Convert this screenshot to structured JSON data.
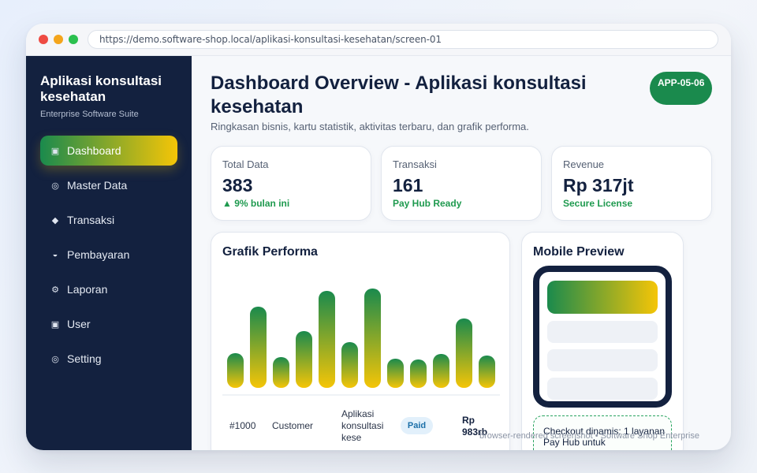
{
  "browser": {
    "url": "https://demo.software-shop.local/aplikasi-konsultasi-kesehatan/screen-01"
  },
  "sidebar": {
    "brand_title": "Aplikasi konsultasi kesehatan",
    "brand_subtitle": "Enterprise Software Suite",
    "items": [
      {
        "label": "Dashboard",
        "icon": "▣",
        "active": true
      },
      {
        "label": "Master Data",
        "icon": "◎",
        "active": false
      },
      {
        "label": "Transaksi",
        "icon": "◆",
        "active": false
      },
      {
        "label": "Pembayaran",
        "icon": "◒",
        "active": false
      },
      {
        "label": "Laporan",
        "icon": "⚙",
        "active": false
      },
      {
        "label": "User",
        "icon": "▣",
        "active": false
      },
      {
        "label": "Setting",
        "icon": "◎",
        "active": false
      }
    ]
  },
  "header": {
    "title": "Dashboard Overview - Aplikasi konsultasi kesehatan",
    "subtitle": "Ringkasan bisnis, kartu statistik, aktivitas terbaru, dan grafik performa.",
    "badge": "APP-05-06"
  },
  "stats": [
    {
      "label": "Total Data",
      "value": "383",
      "note": "▲ 9% bulan ini"
    },
    {
      "label": "Transaksi",
      "value": "161",
      "note": "Pay Hub Ready"
    },
    {
      "label": "Revenue",
      "value": "Rp 317jt",
      "note": "Secure License"
    }
  ],
  "chart": {
    "title": "Grafik Performa"
  },
  "chart_data": {
    "type": "bar",
    "values": [
      44,
      103,
      39,
      72,
      123,
      58,
      126,
      37,
      36,
      43,
      88,
      41
    ]
  },
  "recent_row": {
    "id": "#1000",
    "customer": "Customer",
    "product": "Aplikasi konsultasi kese",
    "status": "Paid",
    "amount": "Rp 983rb"
  },
  "mobile_preview": {
    "title": "Mobile Preview",
    "checkout_text": "Checkout dinamis: 1 layanan Pay Hub untuk"
  },
  "footer": "browser-rendered screenshot • Software Shop Enterprise",
  "colors": {
    "sidebar_bg": "#13213f",
    "accent_green": "#1a8a4d",
    "accent_yellow": "#f5c507",
    "positive_text": "#1f9a4f"
  }
}
